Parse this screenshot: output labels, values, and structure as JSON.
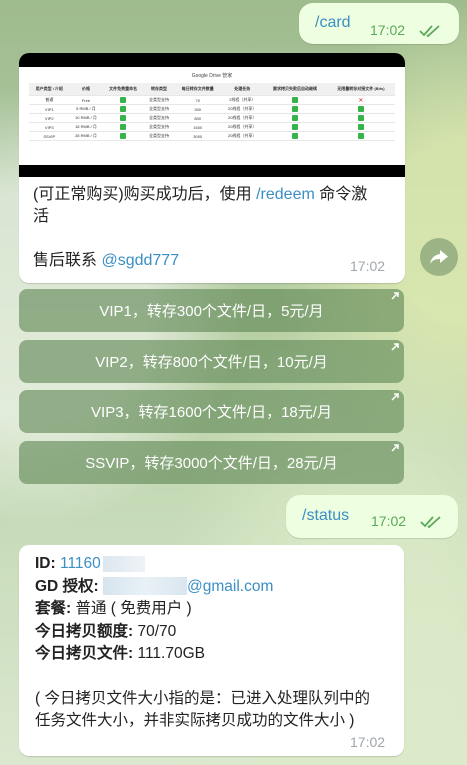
{
  "msg1": {
    "command": "/card",
    "time": "17:02"
  },
  "card": {
    "image": {
      "title": "Google Drive 管家",
      "headers": [
        "用户类型 \\ 介绍",
        "价格",
        "文件免费重命名",
        "转存类型",
        "每日转存文件数量",
        "处理任务",
        "要求拷贝失败后自动继续",
        "无限量转存对接文件 (Bits)"
      ],
      "rows": [
        [
          "普通",
          "Free",
          "check",
          "全类型支持",
          "70",
          "2线程（共享）",
          "check",
          "cross"
        ],
        [
          "VIP1",
          "5 RMB / 月",
          "check",
          "全类型支持",
          "300",
          "20线程（共享）",
          "check",
          "check"
        ],
        [
          "VIP2",
          "10 RMB / 月",
          "check",
          "全类型支持",
          "800",
          "20线程（共享）",
          "check",
          "check"
        ],
        [
          "VIP3",
          "18 RMB / 月",
          "check",
          "全类型支持",
          "1600",
          "20线程（共享）",
          "check",
          "check"
        ],
        [
          "SSVIP",
          "28 RMB / 月",
          "check",
          "全类型支持",
          "3000",
          "20线程（共享）",
          "check",
          "check"
        ]
      ]
    },
    "line1_pre": "(可正常购买)购买成功后，使用 ",
    "line1_link": "/redeem",
    "line1_post": " 命令激",
    "line2": "活",
    "contact_label": "售后联系 ",
    "contact_link": "@sgdd777",
    "time": "17:02"
  },
  "buttons": [
    {
      "label": "VIP1，转存300个文件/日，5元/月"
    },
    {
      "label": "VIP2，转存800个文件/日，10元/月"
    },
    {
      "label": "VIP3，转存1600个文件/日，18元/月"
    },
    {
      "label": "SSVIP，转存3000个文件/日，28元/月"
    }
  ],
  "msg2": {
    "command": "/status",
    "time": "17:02"
  },
  "status": {
    "id_label": "ID: ",
    "id_value": "11160",
    "gd_label": "GD 授权: ",
    "gd_value": "@gmail.com",
    "plan_label": "套餐: ",
    "plan_value": "普通 ( 免费用户 )",
    "quota_label": "今日拷贝额度: ",
    "quota_value": "70/70",
    "files_label": "今日拷贝文件: ",
    "files_value": "111.70GB",
    "note1": "( 今日拷贝文件大小指的是：已进入处理队列中的",
    "note2": "任务文件大小，并非实际拷贝成功的文件大小 )",
    "time": "17:02"
  },
  "colors": {
    "outgoing_bubble": "#eefee0",
    "link": "#3a8fc4",
    "button_bg": "#5f8755"
  },
  "icons": [
    "double-check-icon",
    "share-icon",
    "inline-button-arrow-icon",
    "check-icon",
    "cross-icon"
  ]
}
